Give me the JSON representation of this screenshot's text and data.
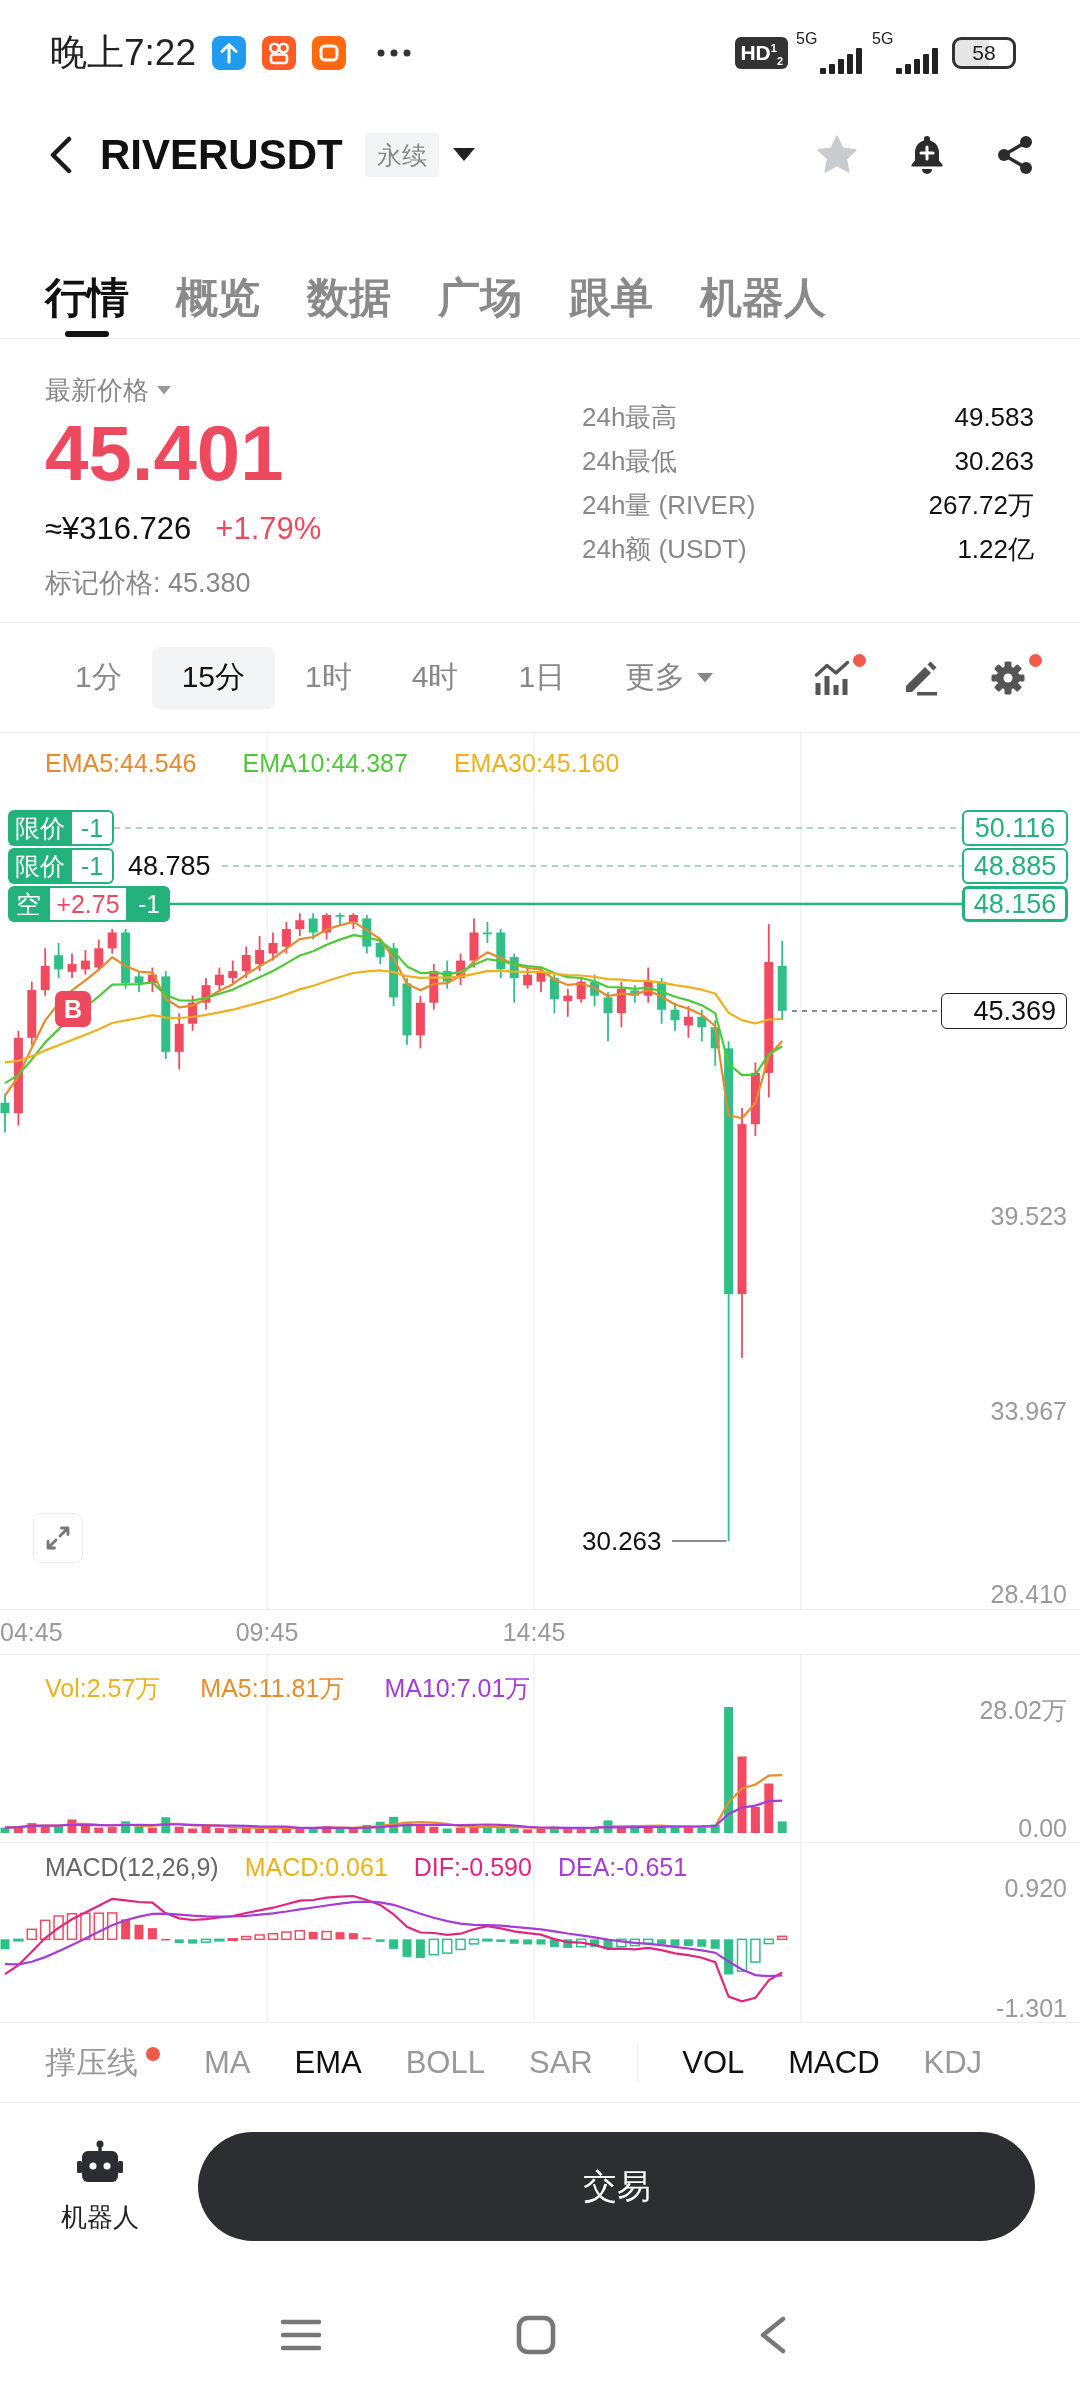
{
  "status_bar": {
    "time": "晚上7:22",
    "network_badge": "HD$^{1}$$_{2}$",
    "networks": [
      "5G",
      "5G"
    ],
    "battery": "58"
  },
  "header": {
    "symbol": "RIVERUSDT",
    "contract_tag": "永续",
    "favorite": false
  },
  "tabs": [
    {
      "label": "行情",
      "selected": true
    },
    {
      "label": "概览",
      "selected": false
    },
    {
      "label": "数据",
      "selected": false
    },
    {
      "label": "广场",
      "selected": false
    },
    {
      "label": "跟单",
      "selected": false
    },
    {
      "label": "机器人",
      "selected": false
    }
  ],
  "price_panel": {
    "price_label": "最新价格",
    "last_price": "45.401",
    "cny_price": "≈¥316.726",
    "change": "+1.79%",
    "mark_price": "标记价格: 45.380",
    "stats": [
      {
        "label": "24h最高",
        "value": "49.583"
      },
      {
        "label": "24h最低",
        "value": "30.263"
      },
      {
        "label": "24h量 (RIVER)",
        "value": "267.72万"
      },
      {
        "label": "24h额 (USDT)",
        "value": "1.22亿"
      }
    ]
  },
  "intervals": [
    {
      "label": "1分",
      "kind": "interval",
      "selected": false
    },
    {
      "label": "15分",
      "kind": "interval",
      "selected": true
    },
    {
      "label": "1时",
      "kind": "interval",
      "selected": false
    },
    {
      "label": "4时",
      "kind": "interval",
      "selected": false
    },
    {
      "label": "1日",
      "kind": "interval",
      "selected": false
    },
    {
      "label": "更多",
      "kind": "dropdown",
      "selected": false
    }
  ],
  "chart_tools": [
    {
      "kind": "indicators",
      "dot": true
    },
    {
      "kind": "drawing",
      "dot": false
    },
    {
      "kind": "settings",
      "dot": true
    }
  ],
  "chart": {
    "legend": [
      {
        "text": "EMA5:44.546",
        "color": "#e8892e"
      },
      {
        "text": "EMA10:44.387",
        "color": "#4fc93a"
      },
      {
        "text": "EMA30:45.160",
        "color": "#f0b01e"
      }
    ],
    "orders": [
      {
        "kind": "limit",
        "type": "限价",
        "qty": "-1",
        "price": "50.116"
      },
      {
        "kind": "limit",
        "type": "限价",
        "qty": "-1",
        "price": "48.885"
      },
      {
        "kind": "position",
        "type": "空",
        "pnl": "+2.75",
        "qty": "-1",
        "price": "48.156"
      }
    ],
    "high_marker": "48.785",
    "trade_marker": "B",
    "last_price": "45.369",
    "axis_labels": [
      "39.523",
      "33.967",
      "28.410"
    ],
    "low_marker": "30.263",
    "time_labels": [
      "04:45",
      "09:45",
      "14:45"
    ]
  },
  "volume": {
    "legend": [
      {
        "text": "Vol:2.57万",
        "color": "#eab21c"
      },
      {
        "text": "MA5:11.81万",
        "color": "#e98c2a"
      },
      {
        "text": "MA10:7.01万",
        "color": "#a63cd6"
      }
    ],
    "axis_labels": [
      "28.02万",
      "0.00"
    ]
  },
  "macd": {
    "legend": [
      {
        "text": "MACD(12,26,9)",
        "color": "#666666"
      },
      {
        "text": "MACD:0.061",
        "color": "#eab21c"
      },
      {
        "text": "DIF:-0.590",
        "color": "#e0267b"
      },
      {
        "text": "DEA:-0.651",
        "color": "#a63cd6"
      }
    ],
    "axis_labels": [
      "0.920",
      "-1.301"
    ]
  },
  "main_indicators": [
    {
      "label": "撑压线",
      "selected": false,
      "dot": true
    },
    {
      "label": "MA",
      "selected": false,
      "dot": false
    },
    {
      "label": "EMA",
      "selected": true,
      "dot": false
    },
    {
      "label": "BOLL",
      "selected": false,
      "dot": false
    },
    {
      "label": "SAR",
      "selected": false,
      "dot": false
    }
  ],
  "sub_indicators": [
    {
      "label": "VOL",
      "selected": true
    },
    {
      "label": "MACD",
      "selected": true
    },
    {
      "label": "KDJ",
      "selected": false
    }
  ],
  "bottom_bar": {
    "robot_label": "机器人",
    "trade_button": "交易"
  }
}
